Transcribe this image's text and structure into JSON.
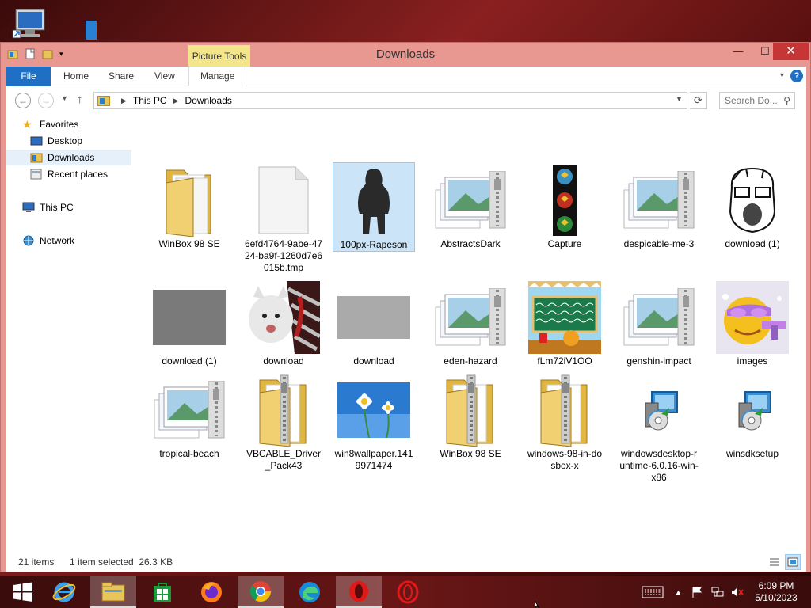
{
  "window": {
    "title": "Downloads",
    "contextual_tab": "Picture Tools",
    "min": "—",
    "max": "☐",
    "close": "✕"
  },
  "ribbon": {
    "tabs": [
      "File",
      "Home",
      "Share",
      "View",
      "Manage"
    ]
  },
  "address": {
    "crumbs": [
      "This PC",
      "Downloads"
    ],
    "search_placeholder": "Search Do..."
  },
  "nav": {
    "favorites": "Favorites",
    "desktop": "Desktop",
    "downloads": "Downloads",
    "recent": "Recent places",
    "thispc": "This PC",
    "network": "Network"
  },
  "files": [
    {
      "name": "WinBox 98 SE",
      "kind": "folder"
    },
    {
      "name": "6efd4764-9abe-4724-ba9f-1260d7e6015b.tmp",
      "kind": "blank"
    },
    {
      "name": "100px-Rapeson",
      "kind": "figure",
      "selected": true
    },
    {
      "name": "AbstractsDark",
      "kind": "zipimg"
    },
    {
      "name": "Capture",
      "kind": "capture"
    },
    {
      "name": "despicable-me-3",
      "kind": "zipimg"
    },
    {
      "name": "download (1)",
      "kind": "sketch"
    },
    {
      "name": "download (1)",
      "kind": "grey"
    },
    {
      "name": "download",
      "kind": "cat"
    },
    {
      "name": "download",
      "kind": "lightgrey"
    },
    {
      "name": "eden-hazard",
      "kind": "zipimg"
    },
    {
      "name": "fLm72iV1OO",
      "kind": "game"
    },
    {
      "name": "genshin-impact",
      "kind": "zipimg"
    },
    {
      "name": "images",
      "kind": "emoji"
    },
    {
      "name": "tropical-beach",
      "kind": "zipimg"
    },
    {
      "name": "VBCABLE_Driver_Pack43",
      "kind": "zipfolder"
    },
    {
      "name": "win8wallpaper.1419971474",
      "kind": "wallpaper"
    },
    {
      "name": "WinBox 98 SE",
      "kind": "zipfolder"
    },
    {
      "name": "windows-98-in-dosbox-x",
      "kind": "zipfolder"
    },
    {
      "name": "windowsdesktop-runtime-6.0.16-win-x86",
      "kind": "installer"
    },
    {
      "name": "winsdksetup",
      "kind": "installer"
    }
  ],
  "status": {
    "count": "21 items",
    "selection": "1 item selected  26.3 KB"
  },
  "clock": {
    "time": "6:09 PM",
    "date": "5/10/2023"
  }
}
